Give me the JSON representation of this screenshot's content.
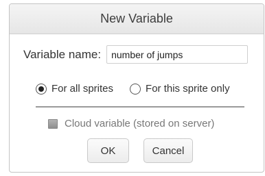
{
  "dialog": {
    "title": "New Variable",
    "name_label": "Variable name:",
    "name_value": "number of jumps",
    "scope_options": [
      {
        "label": "For all sprites",
        "checked": true
      },
      {
        "label": "For this sprite only",
        "checked": false
      }
    ],
    "cloud": {
      "label": "Cloud variable (stored on server)",
      "checked": false
    },
    "ok_label": "OK",
    "cancel_label": "Cancel"
  }
}
